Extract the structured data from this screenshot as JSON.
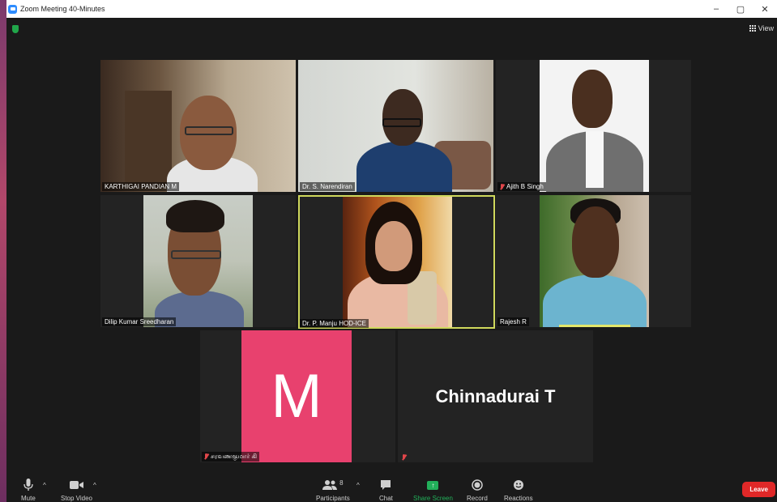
{
  "window": {
    "title": "Zoom Meeting 40-Minutes",
    "controls": [
      "–",
      "▢",
      "✕"
    ]
  },
  "view_button": {
    "label": "View"
  },
  "participants_grid": [
    {
      "name": "KARTHIGAI PANDIAN M",
      "muted": false,
      "active": false
    },
    {
      "name": "Dr. S. Narendiran",
      "muted": false,
      "active": false
    },
    {
      "name": "Ajith B Singh",
      "muted": true,
      "active": false
    },
    {
      "name": "Dilip Kumar Sreedharan",
      "muted": false,
      "active": false
    },
    {
      "name": "Dr. P. Manju HOD-ICE",
      "muted": false,
      "active": true
    },
    {
      "name": "Rajesh R",
      "muted": false,
      "active": false
    },
    {
      "name": "சரவணகுமார் கி",
      "muted": true,
      "active": false,
      "avatar_letter": "M",
      "avatar_color": "#e8416e"
    },
    {
      "name": "",
      "muted": true,
      "active": false,
      "display_name": "Chinnadurai T"
    }
  ],
  "toolbar": {
    "mute": "Mute",
    "stop_video": "Stop Video",
    "participants": "Participants",
    "participants_count": "8",
    "chat": "Chat",
    "share_screen": "Share Screen",
    "record": "Record",
    "reactions": "Reactions",
    "leave": "Leave"
  },
  "colors": {
    "active_speaker_border": "#cfd85c",
    "share_green": "#22b05a",
    "leave_red": "#e02828"
  }
}
